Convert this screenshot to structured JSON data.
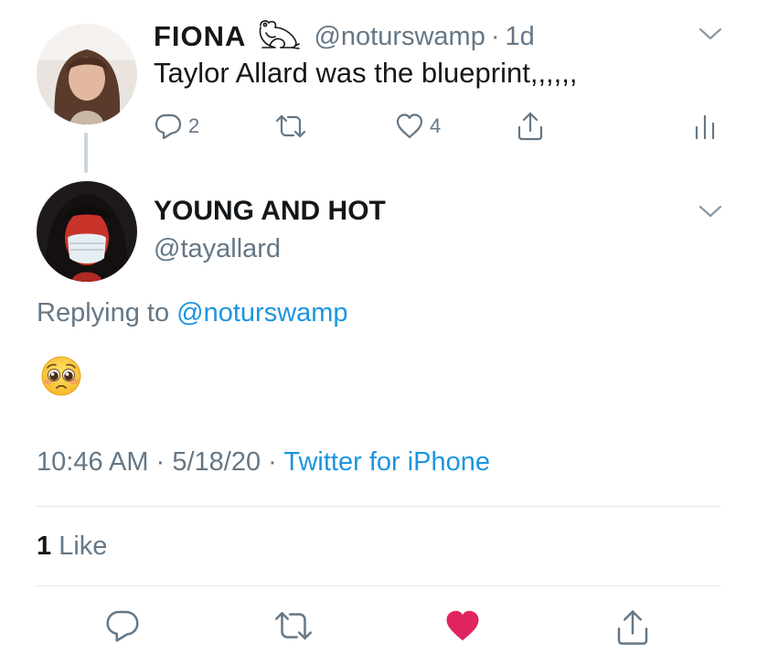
{
  "parent_tweet": {
    "display_name": "FIONA",
    "handle": "@noturswamp",
    "separator": "·",
    "time_ago": "1d",
    "text": "Taylor Allard was the blueprint,,,,,,",
    "reply_count": "2",
    "like_count": "4",
    "icons": [
      "frog-icon",
      "chevron-down-icon",
      "reply-icon",
      "retweet-icon",
      "like-icon",
      "share-icon",
      "analytics-icon"
    ]
  },
  "main_tweet": {
    "display_name": "YOUNG AND HOT",
    "handle": "@tayallard",
    "replying_prefix": "Replying to",
    "replying_handle": "@noturswamp",
    "content_emoji": "pleading-face",
    "time": "10:46 AM",
    "separator": "·",
    "date": "5/18/20",
    "source": "Twitter for iPhone",
    "like_count": "1",
    "like_label": "Like"
  },
  "bottom_actions": {
    "icons": [
      "reply-icon",
      "retweet-icon",
      "liked-heart-icon",
      "share-icon"
    ],
    "liked_color": "#e0245e"
  },
  "colors": {
    "text": "#14171a",
    "secondary": "#657786",
    "link": "#1b95e0",
    "divider": "#e1e8ed",
    "thread_line": "#ccd6dd"
  }
}
